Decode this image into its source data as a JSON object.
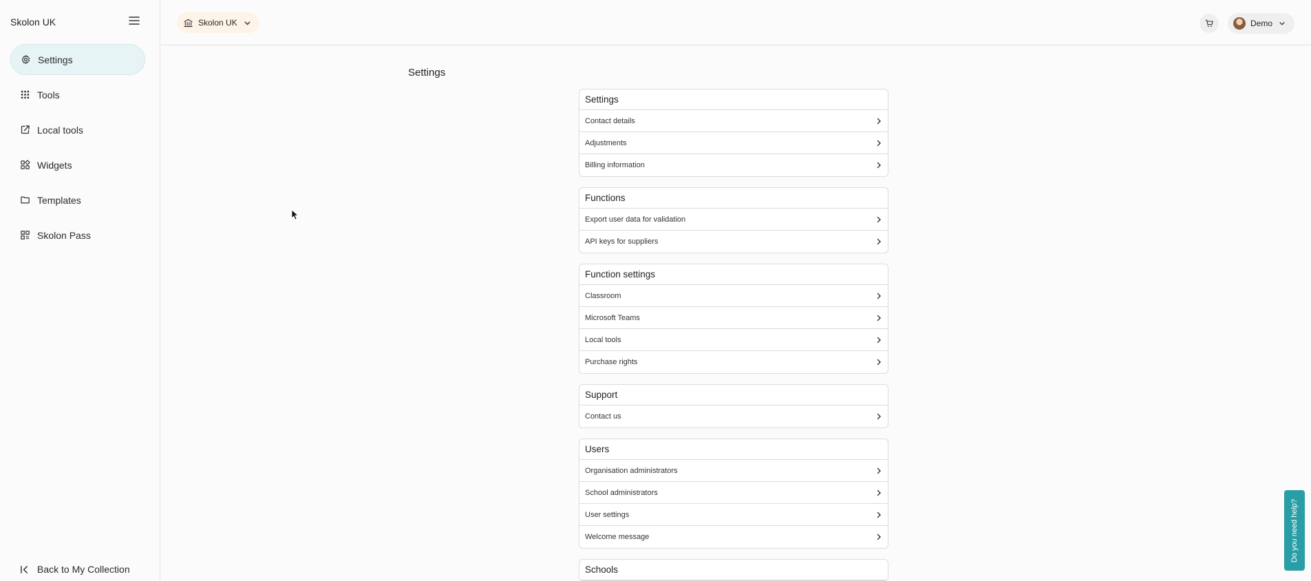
{
  "sidebar": {
    "brand": "Skolon UK",
    "items": [
      {
        "label": "Settings",
        "icon": "gear-icon",
        "active": true
      },
      {
        "label": "Tools",
        "icon": "grid-icon"
      },
      {
        "label": "Local tools",
        "icon": "external-link-icon"
      },
      {
        "label": "Widgets",
        "icon": "widgets-icon"
      },
      {
        "label": "Templates",
        "icon": "folder-icon"
      },
      {
        "label": "Skolon Pass",
        "icon": "qr-code-icon"
      }
    ],
    "back_label": "Back to My Collection"
  },
  "topbar": {
    "org_label": "Skolon UK",
    "user_label": "Demo"
  },
  "main": {
    "title": "Settings",
    "sections": [
      {
        "title": "Settings",
        "items": [
          "Contact details",
          "Adjustments",
          "Billing information"
        ]
      },
      {
        "title": "Functions",
        "items": [
          "Export user data for validation",
          "API keys for suppliers"
        ]
      },
      {
        "title": "Function settings",
        "items": [
          "Classroom",
          "Microsoft Teams",
          "Local tools",
          "Purchase rights"
        ]
      },
      {
        "title": "Support",
        "items": [
          "Contact us"
        ]
      },
      {
        "title": "Users",
        "items": [
          "Organisation administrators",
          "School administrators",
          "User settings",
          "Welcome message"
        ]
      },
      {
        "title": "Schools",
        "items": []
      }
    ]
  },
  "help": {
    "label": "Do you need help?"
  },
  "colors": {
    "accent": "#2a9ea6",
    "active_nav_bg": "#e7f4f6",
    "org_badge_bg": "#fdf3e6"
  }
}
